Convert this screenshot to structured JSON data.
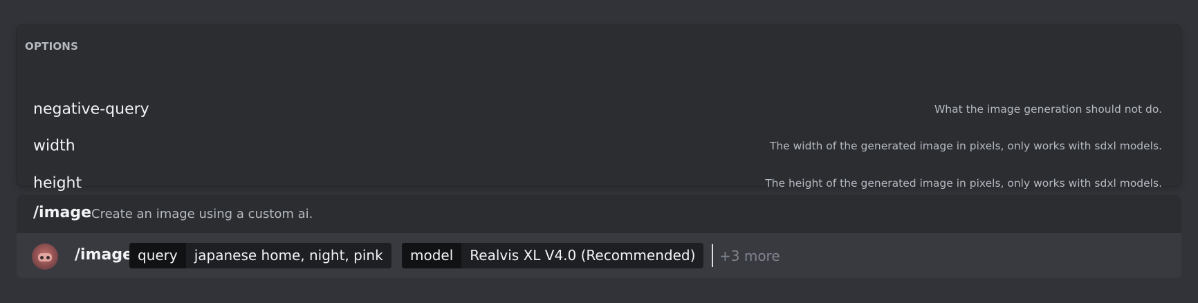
{
  "options": {
    "heading": "OPTIONS",
    "items": [
      {
        "name": "negative-query",
        "description": "What the image generation should not do."
      },
      {
        "name": "width",
        "description": "The width of the generated image in pixels, only works with sdxl models."
      },
      {
        "name": "height",
        "description": "The height of the generated image in pixels, only works with sdxl models."
      }
    ]
  },
  "command": {
    "name": "/image",
    "description": "Create an image using a custom ai."
  },
  "input": {
    "command": "/image",
    "params": [
      {
        "key": "query",
        "value": "japanese home, night, pink"
      },
      {
        "key": "model",
        "value": "Realvis XL V4.0 (Recommended)"
      }
    ],
    "more": "+3 more"
  },
  "colors": {
    "background": "#313338",
    "panel": "#2b2d31",
    "input_row": "#383a40",
    "chip_key": "#111214",
    "chip_value": "#1e1f22"
  }
}
